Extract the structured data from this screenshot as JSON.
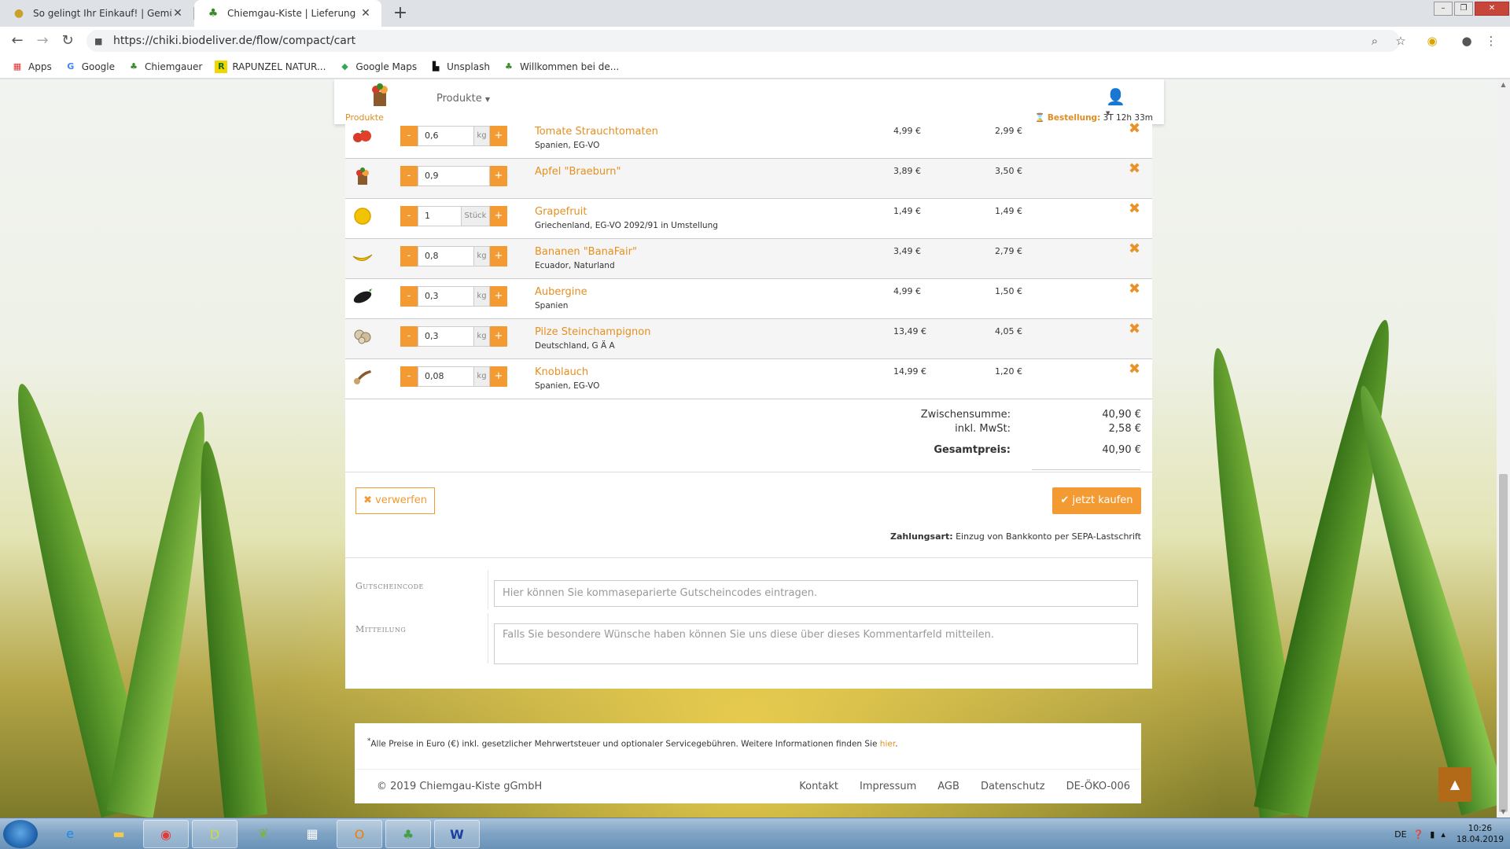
{
  "browser": {
    "tabs": [
      {
        "title": "So gelingt Ihr Einkauf! | Gemüsek",
        "active": false
      },
      {
        "title": "Chiemgau-Kiste | Lieferung | bea",
        "active": true
      }
    ],
    "url": "https://chiki.biodeliver.de/flow/compact/cart",
    "bookmarks": [
      "Apps",
      "Google",
      "Chiemgauer",
      "RAPUNZEL NATUR...",
      "Google Maps",
      "Unsplash",
      "Willkommen bei de..."
    ]
  },
  "header": {
    "logo_label": "Produkte",
    "menu_label": "Produkte",
    "order_label": "Bestellung:",
    "order_time": "3T 12h 33m"
  },
  "cart": {
    "items": [
      {
        "name": "Tomate Strauchtomaten",
        "origin": "Spanien, EG-VO",
        "qty": "0,6",
        "unit": "kg",
        "price": "4,99 €",
        "total": "2,99 €",
        "icon": "tomato-icon"
      },
      {
        "name": "Apfel \"Braeburn\"",
        "origin": "",
        "qty": "0,9",
        "unit": "",
        "price": "3,89 €",
        "total": "3,50 €",
        "icon": "apple-icon"
      },
      {
        "name": "Grapefruit",
        "origin": "Griechenland, EG-VO 2092/91 in Umstellung",
        "qty": "1",
        "unit": "Stück",
        "price": "1,49 €",
        "total": "1,49 €",
        "icon": "grapefruit-icon"
      },
      {
        "name": "Bananen \"BanaFair\"",
        "origin": "Ecuador, Naturland",
        "qty": "0,8",
        "unit": "kg",
        "price": "3,49 €",
        "total": "2,79 €",
        "icon": "banana-icon"
      },
      {
        "name": "Aubergine",
        "origin": "Spanien",
        "qty": "0,3",
        "unit": "kg",
        "price": "4,99 €",
        "total": "1,50 €",
        "icon": "eggplant-icon"
      },
      {
        "name": "Pilze Steinchampignon",
        "origin": "Deutschland, G Ä A",
        "qty": "0,3",
        "unit": "kg",
        "price": "13,49 €",
        "total": "4,05 €",
        "icon": "mushroom-icon"
      },
      {
        "name": "Knoblauch",
        "origin": "Spanien, EG-VO",
        "qty": "0,08",
        "unit": "kg",
        "price": "14,99 €",
        "total": "1,20 €",
        "icon": "garlic-icon"
      }
    ],
    "minus_label": "-",
    "plus_label": "+",
    "remove_label": "✖",
    "subtotal_label": "Zwischensumme:",
    "subtotal": "40,90 €",
    "vat_label": "inkl. MwSt:",
    "vat": "2,58 €",
    "total_label": "Gesamtpreis:",
    "total": "40,90 €",
    "discard_label": "verwerfen",
    "buy_label": "jetzt kaufen",
    "payment_label": "Zahlungsart:",
    "payment_value": "Einzug von Bankkonto per SEPA-Lastschrift"
  },
  "form": {
    "voucher_label": "Gutscheincode",
    "voucher_placeholder": "Hier können Sie kommaseparierte Gutscheincodes eintragen.",
    "message_label": "Mitteilung",
    "message_placeholder": "Falls Sie besondere Wünsche haben können Sie uns diese über dieses Kommentarfeld mitteilen."
  },
  "footer": {
    "note_star": "*",
    "note": "Alle Preise in Euro (€) inkl. gesetzlicher Mehrwertsteuer und optionaler Servicegebühren.  Weitere Informationen finden Sie ",
    "note_link": "hier",
    "note_end": ".",
    "copyright": "© 2019 Chiemgau-Kiste gGmbH",
    "links": [
      "Kontakt",
      "Impressum",
      "AGB",
      "Datenschutz",
      "DE-ÖKO-006"
    ]
  },
  "taskbar": {
    "lang": "DE",
    "time": "10:26",
    "date": "18.04.2019"
  },
  "colors": {
    "accent": "#f39a32",
    "link": "#e59021"
  }
}
